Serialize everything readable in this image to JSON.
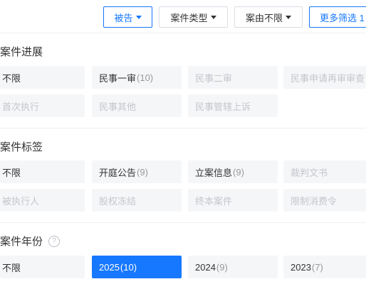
{
  "filters": {
    "defendant": "被告",
    "case_type": "案件类型",
    "cause": "案由不限",
    "more": "更多筛选 1"
  },
  "sections": {
    "progress": {
      "title": "案件进展",
      "items": [
        {
          "label": "不限"
        },
        {
          "label": "民事一审",
          "count": "(10)"
        },
        {
          "label": "民事二审"
        },
        {
          "label": "民事申请再审审查"
        },
        {
          "label": "首次执行"
        },
        {
          "label": "民事其他"
        },
        {
          "label": "民事管辖上诉"
        }
      ]
    },
    "tags": {
      "title": "案件标签",
      "items": [
        {
          "label": "不限"
        },
        {
          "label": "开庭公告",
          "count": "(9)"
        },
        {
          "label": "立案信息",
          "count": "(9)"
        },
        {
          "label": "裁判文书"
        },
        {
          "label": "被执行人"
        },
        {
          "label": "股权冻结"
        },
        {
          "label": "终本案件"
        },
        {
          "label": "限制消费令"
        }
      ]
    },
    "year": {
      "title": "案件年份",
      "help": "?",
      "items": [
        {
          "label": "不限"
        },
        {
          "label": "2025",
          "count": "(10)"
        },
        {
          "label": "2024",
          "count": "(9)"
        },
        {
          "label": "2023",
          "count": "(7)"
        }
      ]
    }
  },
  "colors": {
    "accent": "#1677ff",
    "tag_bg": "#f5f6f8",
    "disabled_text": "#c3c6cc"
  }
}
